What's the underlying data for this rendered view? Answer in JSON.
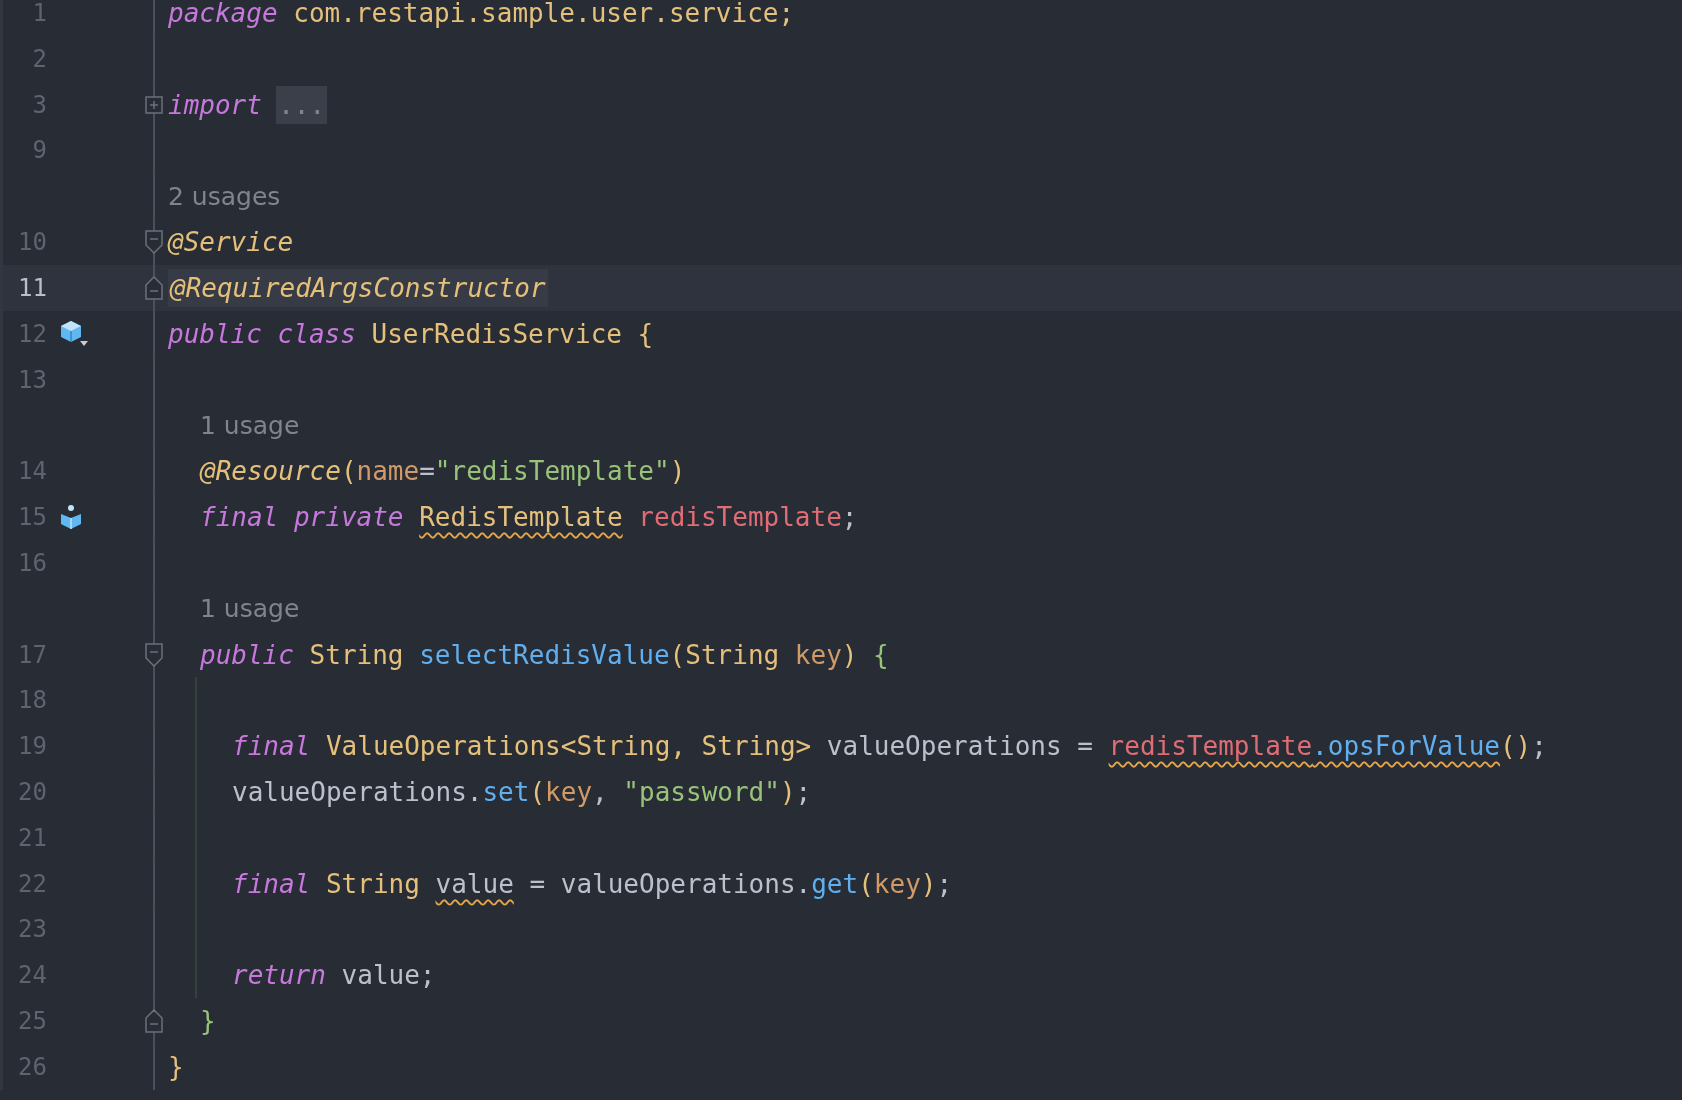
{
  "editor": {
    "lines": [
      {
        "kind": "code",
        "number": "1",
        "current": false,
        "tokens": [
          {
            "text": "package",
            "kind": "keyword"
          },
          {
            "text": " com.restapi.sample.user.service;",
            "kind": "type"
          }
        ]
      },
      {
        "kind": "code",
        "number": "2",
        "current": false
      },
      {
        "kind": "code",
        "number": "3",
        "current": false,
        "fold": {
          "kind": "collapsed"
        },
        "tokens": [
          {
            "text": "import",
            "kind": "keyword"
          },
          {
            "text": "...",
            "kind": "folded"
          }
        ]
      },
      {
        "kind": "code",
        "number": "9",
        "current": false
      },
      {
        "kind": "hint",
        "text": "2 usages"
      },
      {
        "kind": "code",
        "number": "10",
        "current": false,
        "fold": {
          "kind": "start"
        },
        "tokens": [
          {
            "text": "@Service",
            "kind": "annotation"
          }
        ]
      },
      {
        "kind": "code",
        "number": "11",
        "current": true,
        "fold": {
          "kind": "end"
        },
        "tokens": [
          {
            "text": "@RequiredArgsConstructor",
            "kind": "annotation",
            "highlighted": true
          }
        ]
      },
      {
        "kind": "code",
        "number": "12",
        "current": false,
        "marker": {
          "kind": "class"
        },
        "tokens": [
          {
            "text": "public",
            "kind": "keyword"
          },
          {
            "text": " class",
            "kind": "keyword"
          },
          {
            "text": " UserRedisService {",
            "kind": "type"
          }
        ],
        "children": [
          {
            "kind": "code",
            "number": "13",
            "current": false
          },
          {
            "kind": "hint",
            "text": "1 usage"
          },
          {
            "kind": "code",
            "number": "14",
            "current": false,
            "tokens": [
              {
                "text": "@Resource",
                "kind": "annotation"
              },
              {
                "text": "(",
                "kind": "punct"
              },
              {
                "text": "name",
                "kind": "param"
              },
              {
                "text": "=",
                "kind": "plain"
              },
              {
                "text": "\"redisTemplate\"",
                "kind": "string"
              },
              {
                "text": ")",
                "kind": "punct"
              }
            ]
          },
          {
            "kind": "code",
            "number": "15",
            "current": false,
            "marker": {
              "kind": "field"
            },
            "tokens": [
              {
                "text": "final",
                "kind": "keyword"
              },
              {
                "text": " private ",
                "kind": "keyword"
              },
              {
                "text": "RedisTemplate",
                "kind": "type",
                "warning": true
              },
              {
                "text": " redisTemplate",
                "kind": "field"
              },
              {
                "text": ";",
                "kind": "plain"
              }
            ]
          },
          {
            "kind": "code",
            "number": "16",
            "current": false
          },
          {
            "kind": "hint",
            "text": "1 usage"
          },
          {
            "kind": "code",
            "number": "17",
            "current": false,
            "fold": {
              "kind": "start"
            },
            "tokens": [
              {
                "text": "public",
                "kind": "keyword"
              },
              {
                "text": " String",
                "kind": "type"
              },
              {
                "text": " selectRedisValue",
                "kind": "method"
              },
              {
                "text": "(",
                "kind": "punct"
              },
              {
                "text": "String",
                "kind": "type"
              },
              {
                "text": " key",
                "kind": "param"
              },
              {
                "text": ")",
                "kind": "punct"
              },
              {
                "text": " {",
                "kind": "brace"
              }
            ],
            "children": [
              {
                "kind": "code",
                "number": "18",
                "current": false
              },
              {
                "kind": "code",
                "number": "19",
                "current": false,
                "tokens": [
                  {
                    "text": "final",
                    "kind": "keyword"
                  },
                  {
                    "text": " ValueOperations<String, String>",
                    "kind": "type"
                  },
                  {
                    "text": " valueOperations = ",
                    "kind": "plain"
                  },
                  {
                    "text": "redisTemplate",
                    "kind": "field",
                    "warning": true
                  },
                  {
                    "text": ".opsForValue",
                    "kind": "method",
                    "warning": true
                  },
                  {
                    "text": "()",
                    "kind": "punct"
                  },
                  {
                    "text": ";",
                    "kind": "plain"
                  }
                ]
              },
              {
                "kind": "code",
                "number": "20",
                "current": false,
                "tokens": [
                  {
                    "text": "valueOperations.",
                    "kind": "plain"
                  },
                  {
                    "text": "set",
                    "kind": "method"
                  },
                  {
                    "text": "(",
                    "kind": "punct"
                  },
                  {
                    "text": "key",
                    "kind": "param"
                  },
                  {
                    "text": ", ",
                    "kind": "plain"
                  },
                  {
                    "text": "\"password\"",
                    "kind": "string"
                  },
                  {
                    "text": ")",
                    "kind": "punct"
                  },
                  {
                    "text": ";",
                    "kind": "plain"
                  }
                ]
              },
              {
                "kind": "code",
                "number": "21",
                "current": false
              },
              {
                "kind": "code",
                "number": "22",
                "current": false,
                "tokens": [
                  {
                    "text": "final",
                    "kind": "keyword"
                  },
                  {
                    "text": " String ",
                    "kind": "type"
                  },
                  {
                    "text": "value",
                    "kind": "plain",
                    "warning": true
                  },
                  {
                    "text": " = valueOperations.",
                    "kind": "plain"
                  },
                  {
                    "text": "get",
                    "kind": "method"
                  },
                  {
                    "text": "(",
                    "kind": "punct"
                  },
                  {
                    "text": "key",
                    "kind": "param"
                  },
                  {
                    "text": ")",
                    "kind": "punct"
                  },
                  {
                    "text": ";",
                    "kind": "plain"
                  }
                ]
              },
              {
                "kind": "code",
                "number": "23",
                "current": false
              },
              {
                "kind": "code",
                "number": "24",
                "current": false,
                "tokens": [
                  {
                    "text": "return",
                    "kind": "keyword"
                  },
                  {
                    "text": " value;",
                    "kind": "plain"
                  }
                ]
              }
            ]
          },
          {
            "kind": "code",
            "number": "25",
            "current": false,
            "fold": {
              "kind": "end"
            },
            "tokens": [
              {
                "text": "}",
                "kind": "brace"
              }
            ]
          }
        ]
      },
      {
        "kind": "code",
        "number": "26",
        "current": false,
        "tokens": [
          {
            "text": "}",
            "kind": "type"
          }
        ]
      }
    ]
  }
}
